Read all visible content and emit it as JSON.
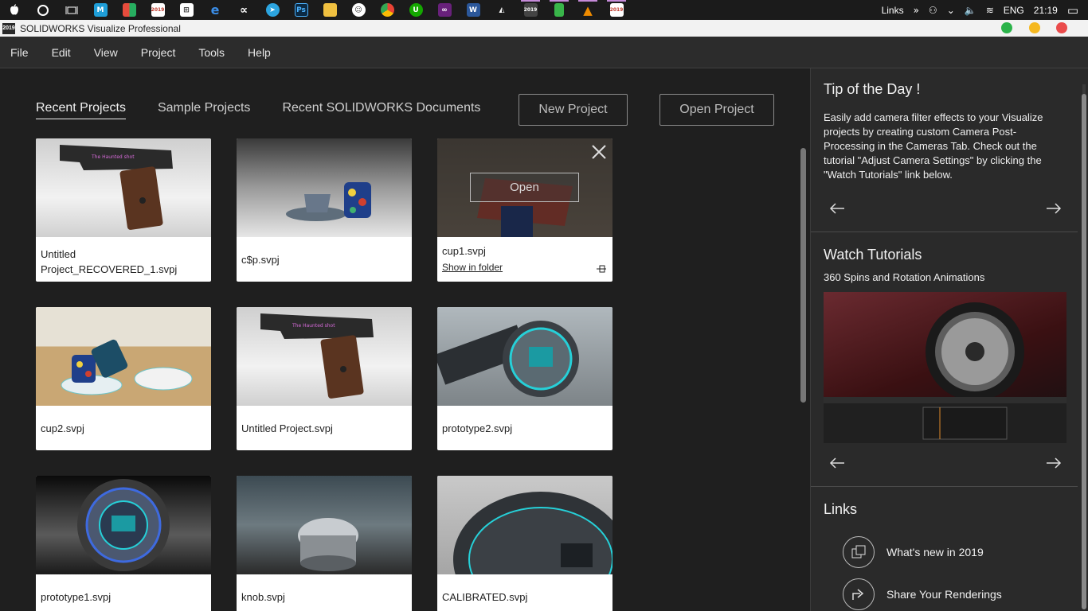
{
  "taskbar": {
    "links_label": "Links",
    "lang": "ENG",
    "time": "21:19",
    "badges": [
      "2019",
      "2019",
      "2019",
      "2019"
    ]
  },
  "window": {
    "title": "SOLIDWORKS Visualize Professional",
    "icon_text": "2019"
  },
  "menu": [
    "File",
    "Edit",
    "View",
    "Project",
    "Tools",
    "Help"
  ],
  "main": {
    "tabs": [
      "Recent Projects",
      "Sample Projects",
      "Recent SOLIDWORKS Documents"
    ],
    "new_project": "New Project",
    "open_project": "Open Project",
    "hover_open": "Open",
    "show_in_folder": "Show in folder",
    "projects": [
      {
        "name": "Untitled Project_RECOVERED_1.svpj",
        "thumb": "pistol"
      },
      {
        "name": "c$p.svpj",
        "thumb": "cup-plate"
      },
      {
        "name": "cup1.svpj",
        "thumb": "cup-hover"
      },
      {
        "name": "cup2.svpj",
        "thumb": "cups-table"
      },
      {
        "name": "Untitled Project.svpj",
        "thumb": "pistol"
      },
      {
        "name": "prototype2.svpj",
        "thumb": "watch-mall"
      },
      {
        "name": "prototype1.svpj",
        "thumb": "watch-dark"
      },
      {
        "name": "knob.svpj",
        "thumb": "knob"
      },
      {
        "name": "CALIBRATED.svpj",
        "thumb": "watch-face"
      }
    ]
  },
  "panel": {
    "tip_heading": "Tip of the Day !",
    "tip_text": "Easily add camera filter effects to your Visualize projects by creating custom Camera Post-Processing in the Cameras Tab. Check out the tutorial \"Adjust Camera Settings\" by clicking the \"Watch Tutorials\" link below.",
    "tutorials_heading": "Watch Tutorials",
    "tutorial_title": "360 Spins and Rotation Animations",
    "links_heading": "Links",
    "links": [
      "What's new in 2019",
      "Share Your Renderings"
    ]
  },
  "colors": {
    "win_green": "#2bb34a",
    "win_yellow": "#f5b820",
    "win_red": "#ea4b4b",
    "accent": "#c58ad8"
  }
}
